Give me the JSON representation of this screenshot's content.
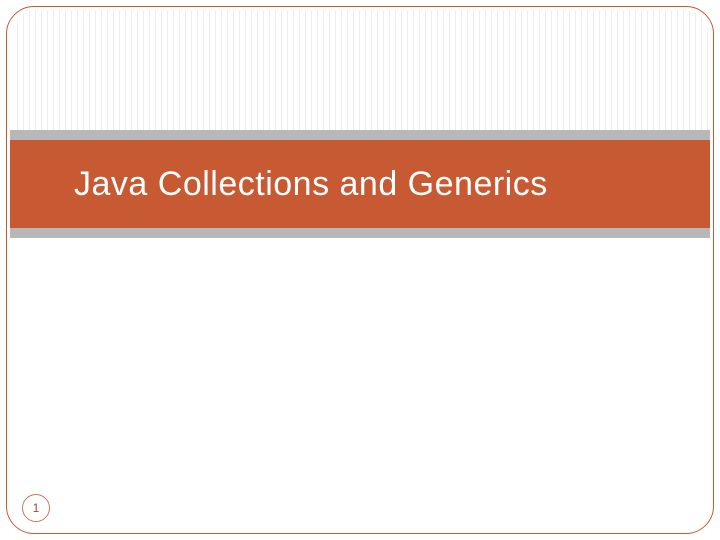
{
  "slide": {
    "title": "Java Collections and Generics",
    "page_number": "1"
  },
  "colors": {
    "accent": "#c75a33",
    "gray_bar": "#b8b8b8",
    "pinstripe": "#eeeeee"
  }
}
